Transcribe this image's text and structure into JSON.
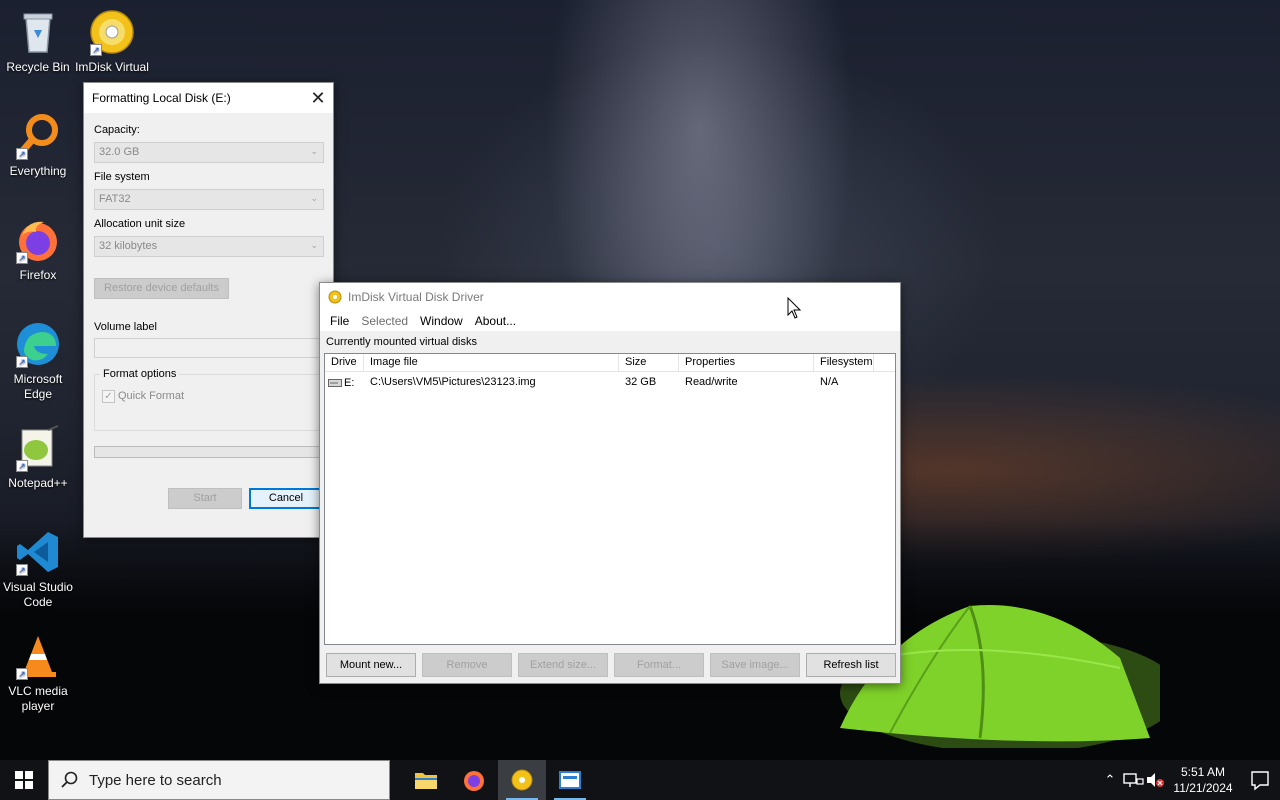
{
  "desktop": {
    "icons": [
      {
        "label": "Recycle Bin"
      },
      {
        "label": "ImDisk Virtual Di..."
      },
      {
        "label": "Everything"
      },
      {
        "label": "Firefox"
      },
      {
        "label": "Microsoft Edge"
      },
      {
        "label": "Notepad++"
      },
      {
        "label": "Visual Studio Code"
      },
      {
        "label": "VLC media player"
      }
    ]
  },
  "format_dialog": {
    "title": "Formatting Local Disk (E:)",
    "capacity_label": "Capacity:",
    "capacity_value": "32.0 GB",
    "filesystem_label": "File system",
    "filesystem_value": "FAT32",
    "allocation_label": "Allocation unit size",
    "allocation_value": "32 kilobytes",
    "restore_button": "Restore device defaults",
    "volume_label": "Volume label",
    "volume_value": "",
    "format_options_label": "Format options",
    "quick_format_label": "Quick Format",
    "quick_format_checked": true,
    "progress": 0,
    "start_button": "Start",
    "cancel_button": "Cancel"
  },
  "imdisk": {
    "title": "ImDisk Virtual Disk Driver",
    "menu": [
      {
        "label": "File",
        "enabled": true
      },
      {
        "label": "Selected",
        "enabled": false
      },
      {
        "label": "Window",
        "enabled": true
      },
      {
        "label": "About...",
        "enabled": true
      }
    ],
    "group_label": "Currently mounted virtual disks",
    "columns": [
      "Drive",
      "Image file",
      "Size",
      "Properties",
      "Filesystem"
    ],
    "rows": [
      {
        "drive": "E:",
        "image": "C:\\Users\\VM5\\Pictures\\23123.img",
        "size": "32 GB",
        "properties": "Read/write",
        "filesystem": "N/A"
      }
    ],
    "buttons": {
      "mount": "Mount new...",
      "remove": "Remove",
      "extend": "Extend size...",
      "format": "Format...",
      "save": "Save image...",
      "refresh": "Refresh list"
    }
  },
  "taskbar": {
    "search_placeholder": "Type here to search",
    "time": "5:51 AM",
    "date": "11/21/2024"
  },
  "colors": {
    "accent": "#0078d7",
    "taskbar": "#101216",
    "window_bg": "#f0f0f0"
  }
}
